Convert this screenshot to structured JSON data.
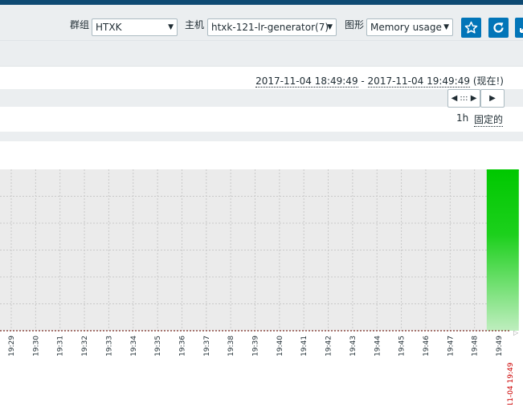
{
  "filters": {
    "group_label": "群组",
    "group_value": "HTXK",
    "host_label": "主机",
    "host_value": "htxk-121-lr-generator(7)",
    "graph_label": "图形",
    "graph_value": "Memory usage"
  },
  "buttons": {
    "favorite_icon": "star-icon",
    "refresh_icon": "refresh-icon",
    "expand_icon": "fullscreen-icon"
  },
  "timeline": {
    "range_start": "2017-11-04 18:49:49",
    "range_sep": " - ",
    "range_end": "2017-11-04 19:49:49",
    "range_suffix": " (现在!)",
    "nav_prev_label": "◀ ::: ▶",
    "nav_next_label": "▶",
    "zoom_label": "1h",
    "fixed_label": "固定的"
  },
  "colors": {
    "accent": "#0275b8",
    "header_dark": "#0e4a73",
    "series_green": "#00c800",
    "now_label_red": "#cc0000"
  },
  "chart_data": {
    "type": "area",
    "series_color": "#00c800",
    "x_ticks": [
      "19:29",
      "19:30",
      "19:31",
      "19:32",
      "19:33",
      "19:34",
      "19:35",
      "19:36",
      "19:37",
      "19:38",
      "19:39",
      "19:40",
      "19:41",
      "19:42",
      "19:43",
      "19:44",
      "19:45",
      "19:46",
      "19:47",
      "19:48",
      "19:49"
    ],
    "now_label": "11-04 19:49",
    "grid": true,
    "series": [
      {
        "x": [
          "19:48:30",
          "19:49:49"
        ],
        "values": [
          1.0,
          1.0
        ]
      }
    ],
    "ylim": [
      0,
      1
    ]
  }
}
